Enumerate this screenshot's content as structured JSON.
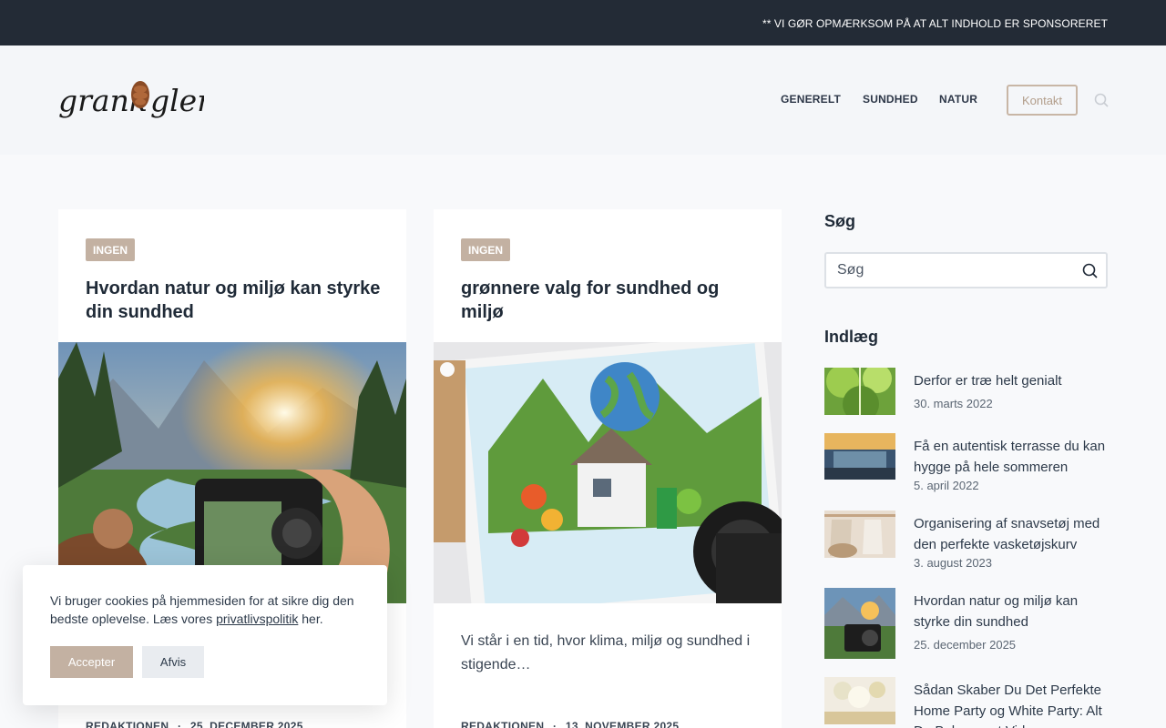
{
  "topbar": {
    "notice": "** VI GØR OPMÆRKSOM PÅ AT ALT INDHOLD ER SPONSORERET"
  },
  "header": {
    "logo_text": "grankoglen",
    "nav": [
      "GENERELT",
      "SUNDHED",
      "NATUR"
    ],
    "contact_label": "Kontakt"
  },
  "posts": [
    {
      "category": "INGEN",
      "title": "Hvordan natur og miljø kan styrke din sundhed",
      "excerpt": "",
      "author": "REDAKTIONEN",
      "date": "25. DECEMBER 2025"
    },
    {
      "category": "INGEN",
      "title": "grønnere valg for sundhed og miljø",
      "excerpt": "Vi står i en tid, hvor klima, miljø og sundhed i stigende…",
      "author": "REDAKTIONEN",
      "date": "13. NOVEMBER 2025"
    }
  ],
  "meta_separator": "·",
  "sidebar": {
    "search_heading": "Søg",
    "search_placeholder": "Søg",
    "posts_heading": "Indlæg",
    "recent": [
      {
        "title": "Derfor er træ helt genialt",
        "date": "30. marts 2022"
      },
      {
        "title": "Få en autentisk terrasse du kan hygge på hele sommeren",
        "date": "5. april 2022"
      },
      {
        "title": "Organisering af snavsetøj med den perfekte vasketøjskurv",
        "date": "3. august 2023"
      },
      {
        "title": "Hvordan natur og miljø kan styrke din sundhed",
        "date": "25. december 2025"
      },
      {
        "title": "Sådan Skaber Du Det Perfekte Home Party og White Party: Alt Du Behøver at Vide",
        "date": ""
      }
    ]
  },
  "cookie": {
    "text_before": "Vi bruger cookies på hjemmesiden for at sikre dig den bedste oplevelse. Læs vores ",
    "link_text": "privatlivspolitik",
    "text_after": " her.",
    "accept_label": "Accepter",
    "decline_label": "Afvis"
  },
  "colors": {
    "accent": "#c3b1a2",
    "topbar": "#232b36",
    "text": "#1f2a37"
  }
}
